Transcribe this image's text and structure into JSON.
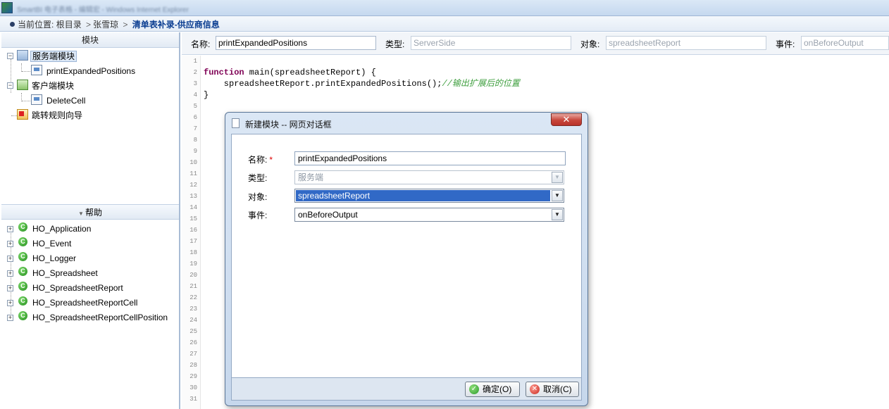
{
  "window": {
    "title": "SmartBI 电子表格 - 编辑宏 - Windows Internet Explorer"
  },
  "breadcrumb": {
    "prefix": "当前位置:",
    "items": [
      "根目录",
      "张雪琼"
    ],
    "separators": [
      ">",
      ">"
    ],
    "current": "清单表补录-供应商信息"
  },
  "modules": {
    "header": "模块",
    "server": {
      "label": "服务端模块",
      "children": [
        "printExpandedPositions"
      ]
    },
    "client": {
      "label": "客户端模块",
      "children": [
        "DeleteCell"
      ]
    },
    "wizard": {
      "label": "跳转规则向导"
    }
  },
  "help": {
    "header": "帮助",
    "classes": [
      "HO_Application",
      "HO_Event",
      "HO_Logger",
      "HO_Spreadsheet",
      "HO_SpreadsheetReport",
      "HO_SpreadsheetReportCell",
      "HO_SpreadsheetReportCellPosition"
    ],
    "class_badge": "C"
  },
  "properties": {
    "name_label": "名称:",
    "name_value": "printExpandedPositions",
    "type_label": "类型:",
    "type_value": "ServerSide",
    "object_label": "对象:",
    "object_value": "spreadsheetReport",
    "event_label": "事件:",
    "event_value": "onBeforeOutput"
  },
  "code": {
    "line_numbers": [
      "1",
      "2",
      "3",
      "4",
      "5",
      "6",
      "7",
      "8",
      "9",
      "10",
      "11",
      "12",
      "13",
      "14",
      "15",
      "16",
      "17",
      "18",
      "19",
      "20",
      "21",
      "22",
      "23",
      "24",
      "25",
      "26",
      "27",
      "28",
      "29",
      "30",
      "31"
    ],
    "line2_kw": "function",
    "line2_rest": " main(spreadsheetReport) {",
    "line3_code": "    spreadsheetReport.printExpandedPositions();",
    "line3_comment": "//输出扩展后的位置",
    "line4": "}"
  },
  "dialog": {
    "title": "新建模块 -- 网页对话框",
    "close_glyph": "✕",
    "name_label": "名称:",
    "required_mark": "*",
    "name_value": "printExpandedPositions",
    "type_label": "类型:",
    "type_value": "服务端",
    "object_label": "对象:",
    "object_value": "spreadsheetReport",
    "event_label": "事件:",
    "event_value": "onBeforeOutput",
    "ok_label": "确定(O)",
    "cancel_label": "取消(C)",
    "ok_glyph": "✓",
    "cancel_glyph": "✕"
  },
  "icons": {
    "dropdown_glyph": "▼",
    "expand_glyph": "+",
    "collapse_glyph": "−",
    "help_arrow_glyph": "▼"
  },
  "colors": {
    "breadcrumb_current": "#0a3d91",
    "keyword": "#7f0055",
    "comment": "#3f9f3f",
    "selection": "#3169c6",
    "class_icon": "#1f8a1a"
  }
}
